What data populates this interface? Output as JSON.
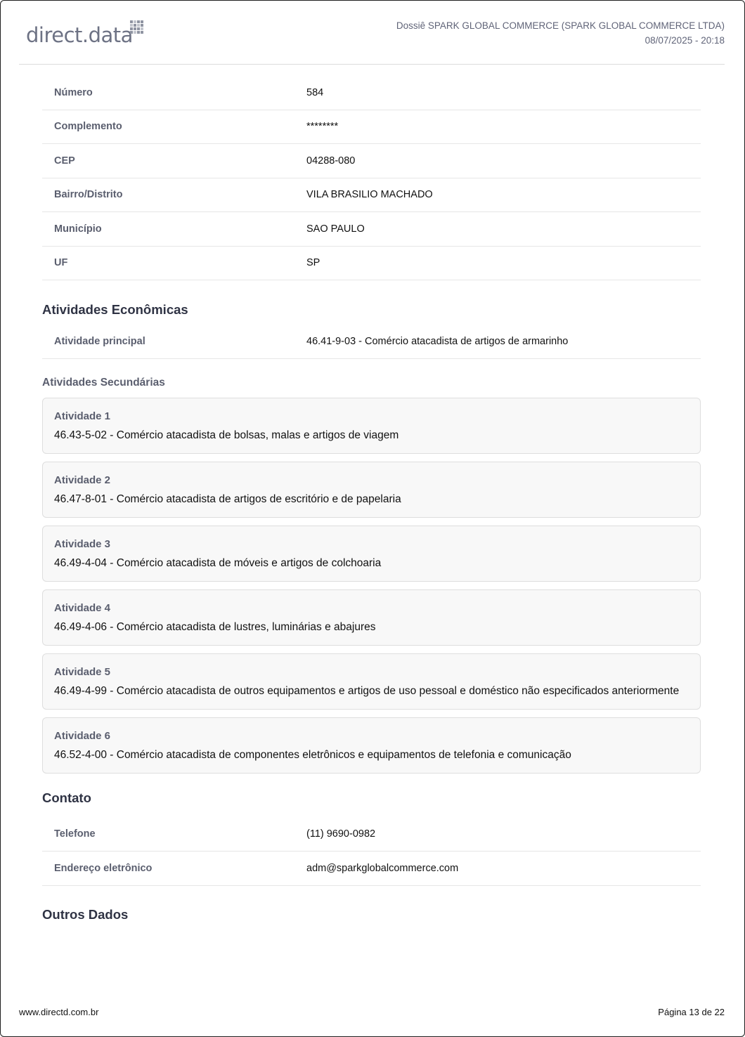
{
  "header": {
    "logo_text": "direct.data",
    "title": "Dossiê SPARK GLOBAL COMMERCE (SPARK GLOBAL COMMERCE LTDA)",
    "datetime": "08/07/2025 - 20:18"
  },
  "address": [
    {
      "label": "Número",
      "value": "584"
    },
    {
      "label": "Complemento",
      "value": "********"
    },
    {
      "label": "CEP",
      "value": "04288-080"
    },
    {
      "label": "Bairro/Distrito",
      "value": "VILA BRASILIO MACHADO"
    },
    {
      "label": "Município",
      "value": "SAO PAULO"
    },
    {
      "label": "UF",
      "value": "SP"
    }
  ],
  "economic": {
    "title": "Atividades Econômicas",
    "main_label": "Atividade principal",
    "main_value": "46.41-9-03 - Comércio atacadista de artigos de armarinho",
    "secondary_title": "Atividades Secundárias",
    "secondary": [
      {
        "name": "Atividade 1",
        "desc": "46.43-5-02 - Comércio atacadista de bolsas, malas e artigos de viagem"
      },
      {
        "name": "Atividade 2",
        "desc": "46.47-8-01 - Comércio atacadista de artigos de escritório e de papelaria"
      },
      {
        "name": "Atividade 3",
        "desc": "46.49-4-04 - Comércio atacadista de móveis e artigos de colchoaria"
      },
      {
        "name": "Atividade 4",
        "desc": "46.49-4-06 - Comércio atacadista de lustres, luminárias e abajures"
      },
      {
        "name": "Atividade 5",
        "desc": "46.49-4-99 - Comércio atacadista de outros equipamentos e artigos de uso pessoal e doméstico não especificados anteriormente"
      },
      {
        "name": "Atividade 6",
        "desc": "46.52-4-00 - Comércio atacadista de componentes eletrônicos e equipamentos de telefonia e comunicação"
      }
    ]
  },
  "contact": {
    "title": "Contato",
    "rows": [
      {
        "label": "Telefone",
        "value": "(11) 9690-0982"
      },
      {
        "label": "Endereço eletrônico",
        "value": "adm@sparkglobalcommerce.com"
      }
    ]
  },
  "other": {
    "title": "Outros Dados"
  },
  "footer": {
    "site": "www.directd.com.br",
    "page": "Página 13 de 22"
  }
}
